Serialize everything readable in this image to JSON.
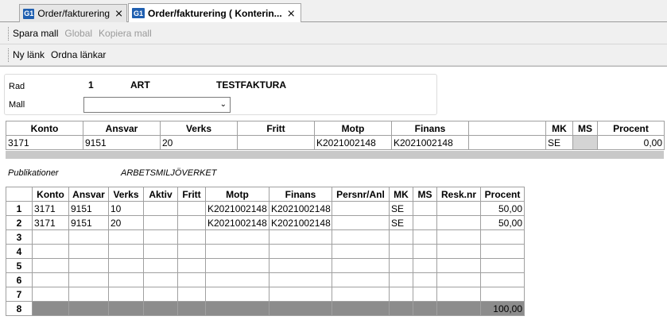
{
  "tabs": [
    {
      "logo": "G1",
      "label": "Order/fakturering",
      "close": "⨯"
    },
    {
      "logo": "G1",
      "label": "Order/fakturering ( Konterin...",
      "close": "⨯"
    }
  ],
  "toolbar1": {
    "spara_mall": "Spara mall",
    "global": "Global",
    "kopiera_mall": "Kopiera mall"
  },
  "toolbar2": {
    "ny_lank": "Ny länk",
    "ordna_lankar": "Ordna länkar"
  },
  "header": {
    "rad_label": "Rad",
    "rad_value": "1",
    "art": "ART",
    "testfaktura": "TESTFAKTURA",
    "mall_label": "Mall",
    "mall_value": ""
  },
  "top_table": {
    "columns": [
      "Konto",
      "Ansvar",
      "Verks",
      "Fritt",
      "Motp",
      "Finans",
      "",
      "MK",
      "MS",
      "Procent"
    ],
    "row": [
      "3171",
      "9151",
      "20",
      "",
      "K2021002148",
      "K2021002148",
      "",
      "SE",
      "",
      "0,00"
    ]
  },
  "publikationer": {
    "label": "Publikationer",
    "value": "ARBETSMILJÖVERKET"
  },
  "bottom_table": {
    "columns": [
      "Konto",
      "Ansvar",
      "Verks",
      "Aktiv",
      "Fritt",
      "Motp",
      "Finans",
      "Persnr/Anl",
      "MK",
      "MS",
      "Resk.nr",
      "Procent"
    ],
    "rows": [
      {
        "n": "1",
        "cells": [
          "3171",
          "9151",
          "10",
          "",
          "",
          "K2021002148",
          "K2021002148",
          "",
          "SE",
          "",
          "",
          "50,00"
        ]
      },
      {
        "n": "2",
        "cells": [
          "3171",
          "9151",
          "20",
          "",
          "",
          "K2021002148",
          "K2021002148",
          "",
          "SE",
          "",
          "",
          "50,00"
        ]
      },
      {
        "n": "3",
        "cells": [
          "",
          "",
          "",
          "",
          "",
          "",
          "",
          "",
          "",
          "",
          "",
          ""
        ]
      },
      {
        "n": "4",
        "cells": [
          "",
          "",
          "",
          "",
          "",
          "",
          "",
          "",
          "",
          "",
          "",
          ""
        ]
      },
      {
        "n": "5",
        "cells": [
          "",
          "",
          "",
          "",
          "",
          "",
          "",
          "",
          "",
          "",
          "",
          ""
        ]
      },
      {
        "n": "6",
        "cells": [
          "",
          "",
          "",
          "",
          "",
          "",
          "",
          "",
          "",
          "",
          "",
          ""
        ]
      },
      {
        "n": "7",
        "cells": [
          "",
          "",
          "",
          "",
          "",
          "",
          "",
          "",
          "",
          "",
          "",
          ""
        ]
      }
    ],
    "total": {
      "n": "8",
      "procent": "100,00"
    }
  }
}
